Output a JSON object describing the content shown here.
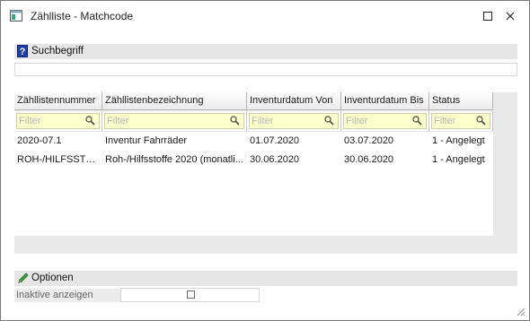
{
  "window": {
    "title": "Zählliste - Matchcode",
    "icons": {
      "app": "window-icon",
      "maximize": "maximize-icon",
      "close": "close-icon"
    }
  },
  "search_section": {
    "label": "Suchbegriff",
    "icon": "help-icon",
    "input_value": ""
  },
  "grid": {
    "columns": [
      {
        "label": "Zähllistennummer"
      },
      {
        "label": "Zähllistenbezeichnung"
      },
      {
        "label": "Inventurdatum Von"
      },
      {
        "label": "Inventurdatum Bis"
      },
      {
        "label": "Status"
      }
    ],
    "filter_placeholder": "Filter",
    "rows": [
      [
        "2020-07.1",
        "Inventur Fahrräder",
        "01.07.2020",
        "03.07.2020",
        "1 - Angelegt"
      ],
      [
        "ROH-/HILFSSTO...",
        "Roh-/Hilfsstoffe 2020 (monatli...",
        "30.06.2020",
        "30.06.2020",
        "1 - Angelegt"
      ]
    ]
  },
  "options_section": {
    "label": "Optionen",
    "icon": "pencil-icon",
    "inactive_label": "Inaktive anzeigen",
    "inactive_checked": false
  },
  "colors": {
    "section_bar": "#e6e6e6",
    "filter_bg": "#ffffcc",
    "help_icon": "#1e3fa8",
    "pencil": "#2e8b2e"
  }
}
